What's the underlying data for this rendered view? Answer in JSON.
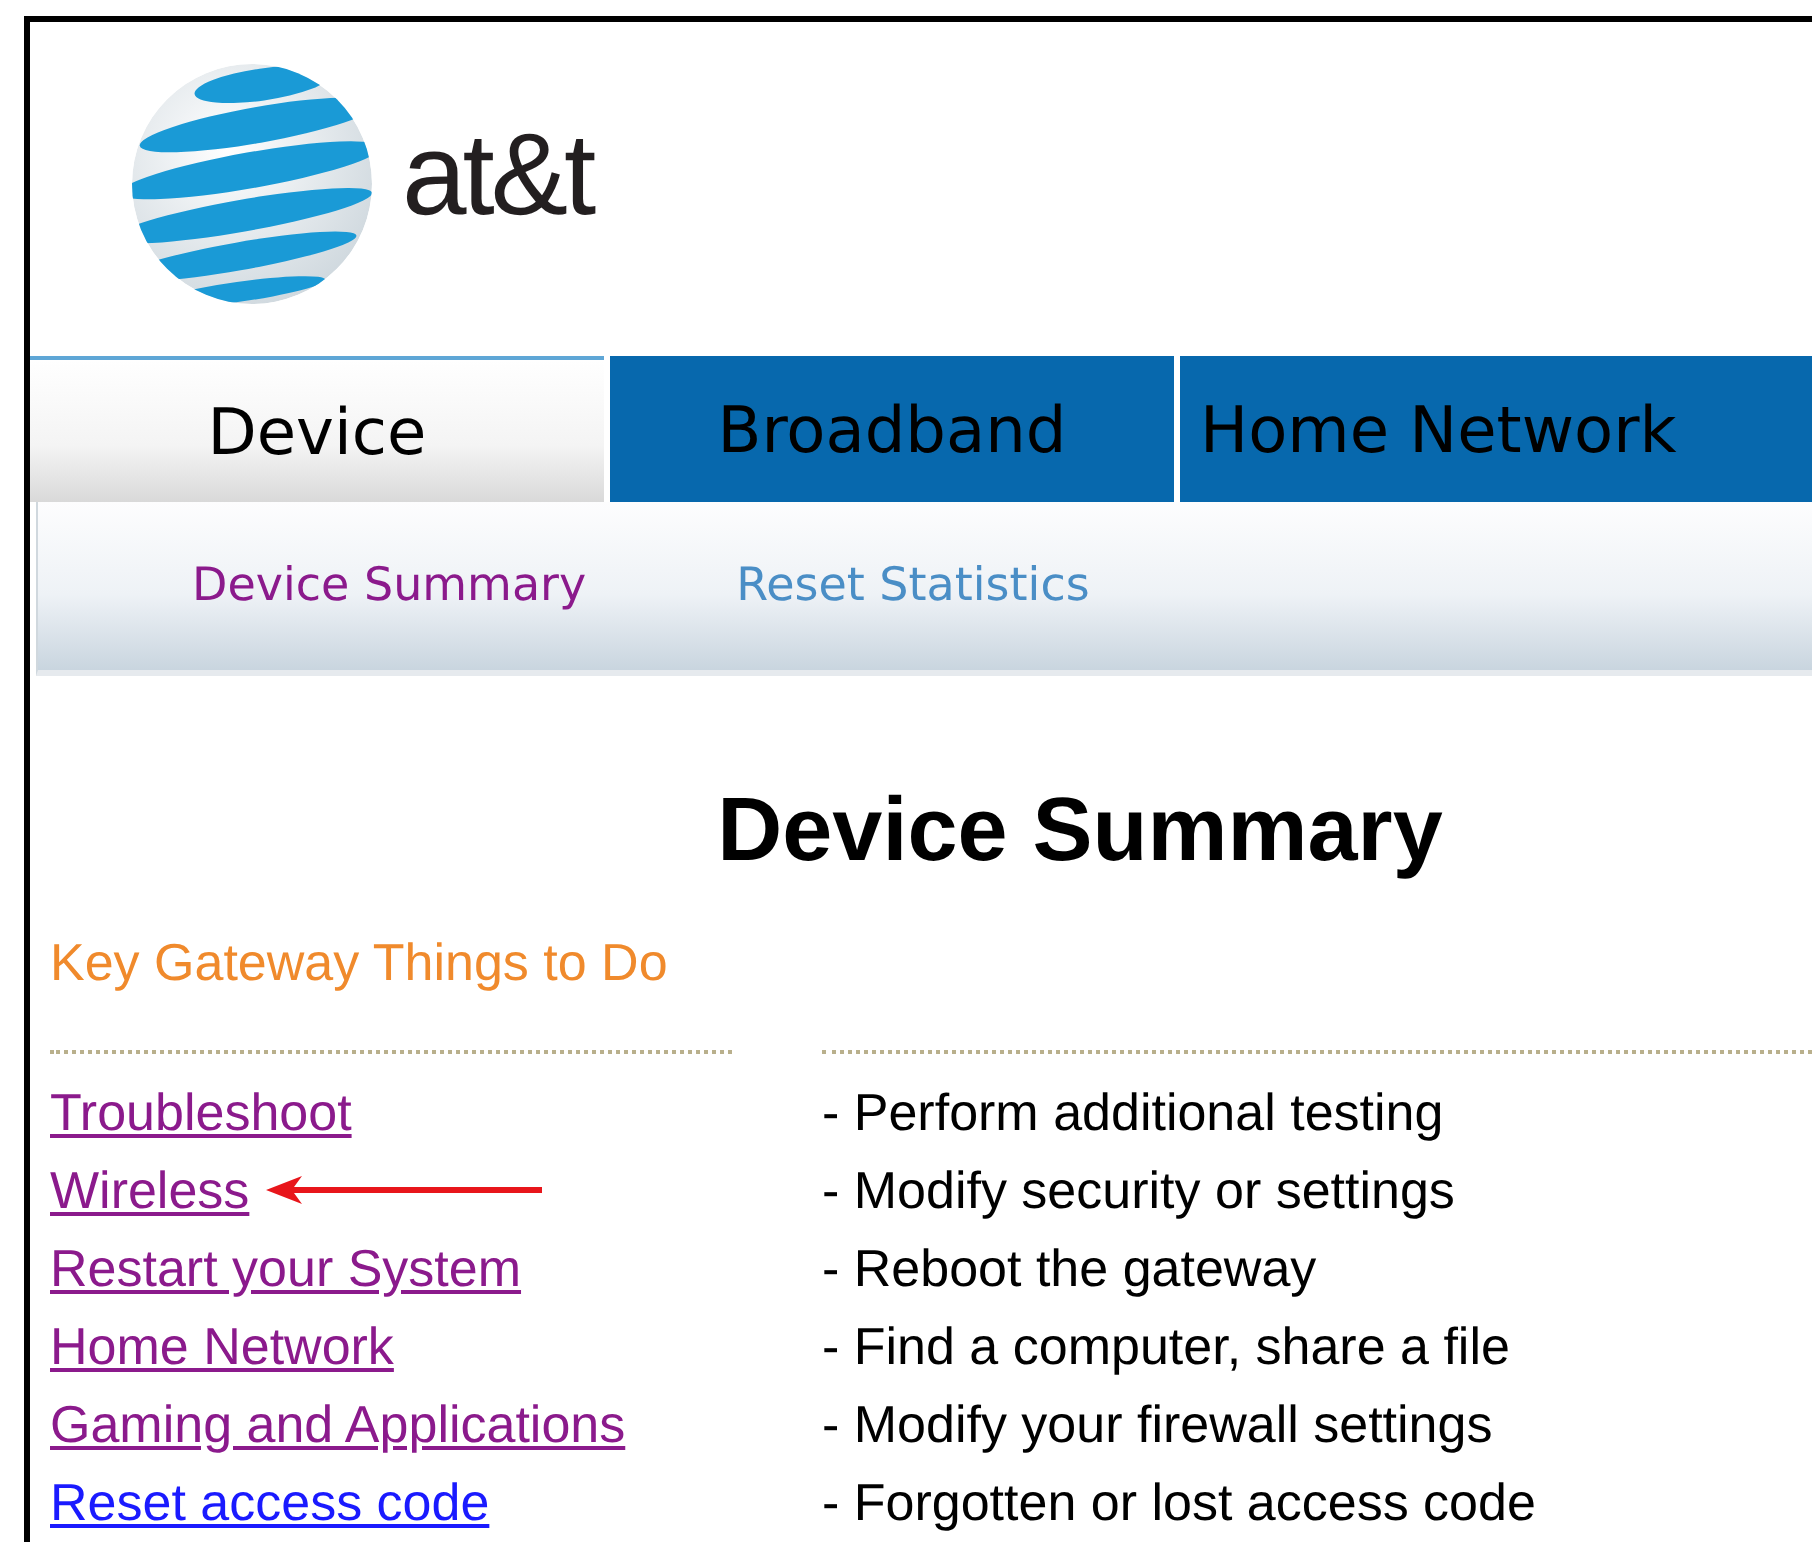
{
  "logo": {
    "text": "at&t"
  },
  "tabs": [
    {
      "label": "Device",
      "selected": true
    },
    {
      "label": "Broadband",
      "selected": false
    },
    {
      "label": "Home Network",
      "selected": false
    }
  ],
  "subnav": [
    {
      "label": "Device Summary",
      "selected": true
    },
    {
      "label": "Reset Statistics",
      "selected": false
    }
  ],
  "heading": "Device Summary",
  "section_title": "Key Gateway Things to Do",
  "tasks": [
    {
      "link": "Troubleshoot",
      "description": "- Perform additional testing",
      "visited": true,
      "pointed_at": false
    },
    {
      "link": "Wireless",
      "description": "- Modify security or settings",
      "visited": true,
      "pointed_at": true
    },
    {
      "link": "Restart your System",
      "description": "- Reboot the gateway",
      "visited": true,
      "pointed_at": false
    },
    {
      "link": "Home Network",
      "description": "- Find a computer, share a file",
      "visited": true,
      "pointed_at": false
    },
    {
      "link": "Gaming and Applications",
      "description": "- Modify your firewall settings",
      "visited": true,
      "pointed_at": false
    },
    {
      "link": "Reset access code",
      "description": "- Forgotten or lost access code",
      "visited": false,
      "pointed_at": false
    }
  ]
}
